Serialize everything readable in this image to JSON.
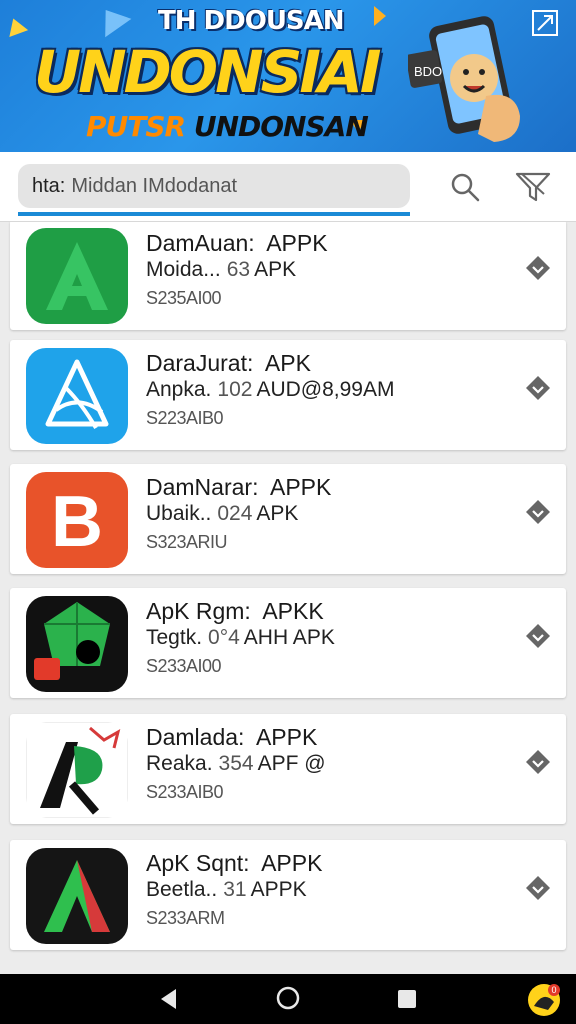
{
  "banner": {
    "line1": "TH DDOUSAN",
    "line2": "UNDONSIAI",
    "line3_a": "PUTSR",
    "line3_b": "UNDONSAN",
    "phone_label": "BDO",
    "colors": {
      "bg": "#2a96ea",
      "headline": "#ffd21a",
      "accent": "#ff8a00"
    }
  },
  "search": {
    "prefix": "hta:",
    "placeholder": "Middan IMdodanat",
    "icons": [
      "search-icon",
      "filter-icon"
    ]
  },
  "apps": [
    {
      "name": "DamAuan:",
      "tag": "APPK",
      "sub": "Moida...",
      "num": "63",
      "ext": "APK",
      "code": "S235AI00",
      "icon": "green-a-logo"
    },
    {
      "name": "DaraJurat:",
      "tag": "APK",
      "sub": "Anpka.",
      "num": "102",
      "ext": "AUD@8,99AM",
      "code": "S223AIB0",
      "icon": "blue-ribbon-a-logo"
    },
    {
      "name": "DamNarar:",
      "tag": "APPK",
      "sub": "Ubaik..",
      "num": "024",
      "ext": "APK",
      "code": "S323ARIU",
      "icon": "orange-b-logo"
    },
    {
      "name": "ApK Rgm:",
      "tag": "APKK",
      "sub": "Tegtk.",
      "num": "0°4",
      "ext": "AHH APK",
      "code": "S233AI00",
      "icon": "dark-gem-logo"
    },
    {
      "name": "Damlada:",
      "tag": "APPK",
      "sub": "Reaka.",
      "num": "354",
      "ext": "APF @",
      "code": "S233AIB0",
      "icon": "ap-red-crown-logo"
    },
    {
      "name": "ApK Sqnt:",
      "tag": "APPK",
      "sub": "Beetla..",
      "num": "31",
      "ext": "APPK",
      "code": "S233ARM",
      "icon": "dark-green-a-logo"
    }
  ],
  "nav": {
    "items": [
      "back-icon",
      "home-icon",
      "recents-icon"
    ],
    "badge": "0"
  }
}
